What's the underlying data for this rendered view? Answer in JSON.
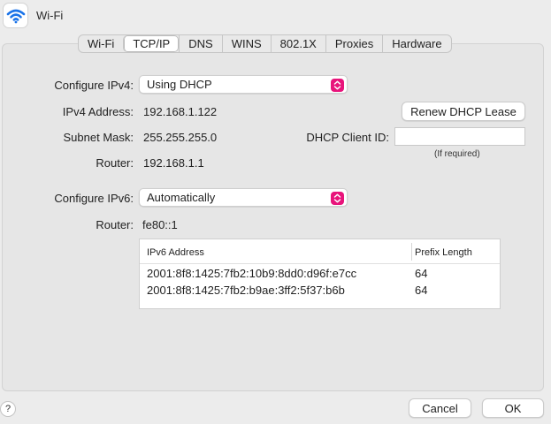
{
  "window": {
    "title": "Wi-Fi",
    "icon": "wifi-icon"
  },
  "tabs": [
    {
      "label": "Wi-Fi",
      "active": false
    },
    {
      "label": "TCP/IP",
      "active": true
    },
    {
      "label": "DNS",
      "active": false
    },
    {
      "label": "WINS",
      "active": false
    },
    {
      "label": "802.1X",
      "active": false
    },
    {
      "label": "Proxies",
      "active": false
    },
    {
      "label": "Hardware",
      "active": false
    }
  ],
  "ipv4": {
    "configure_label": "Configure IPv4:",
    "configure_value": "Using DHCP",
    "address_label": "IPv4 Address:",
    "address_value": "192.168.1.122",
    "subnet_label": "Subnet Mask:",
    "subnet_value": "255.255.255.0",
    "router_label": "Router:",
    "router_value": "192.168.1.1",
    "renew_button": "Renew DHCP Lease",
    "client_id_label": "DHCP Client ID:",
    "client_id_value": "",
    "client_id_hint": "(If required)"
  },
  "ipv6": {
    "configure_label": "Configure IPv6:",
    "configure_value": "Automatically",
    "router_label": "Router:",
    "router_value": "fe80::1",
    "table": {
      "headers": [
        "IPv6 Address",
        "Prefix Length"
      ],
      "rows": [
        {
          "address": "2001:8f8:1425:7fb2:10b9:8dd0:d96f:e7cc",
          "prefix": "64"
        },
        {
          "address": "2001:8f8:1425:7fb2:b9ae:3ff2:5f37:b6b",
          "prefix": "64"
        }
      ]
    }
  },
  "footer": {
    "help": "?",
    "cancel": "Cancel",
    "ok": "OK"
  },
  "colors": {
    "accent": "#e8147b",
    "wifi_icon": "#1a73e8",
    "panel": "#e6e6e6",
    "window": "#ececec"
  }
}
